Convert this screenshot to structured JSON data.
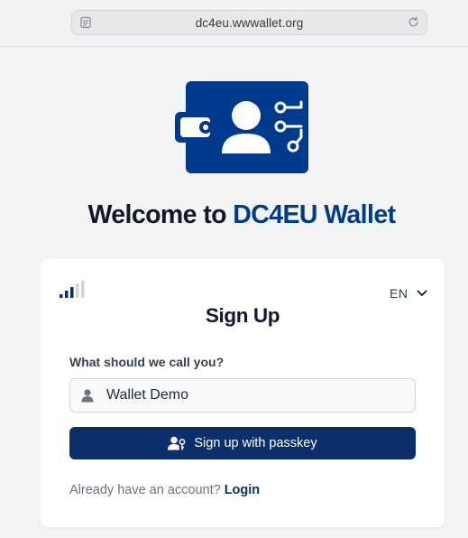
{
  "browser": {
    "url": "dc4eu.wwwallet.org",
    "reader_icon": "reader-mode-icon",
    "reload_icon": "reload-icon"
  },
  "logo": {
    "icon": "wallet-identity-circuit-logo",
    "color": "#003a8c"
  },
  "welcome": {
    "prefix": "Welcome to ",
    "brand": "DC4EU Wallet"
  },
  "card": {
    "connection_icon": "signal-strength-icon",
    "language": {
      "selected": "EN",
      "icon": "chevron-down-icon"
    },
    "title": "Sign Up",
    "name_field": {
      "label": "What should we call you?",
      "value": "Wallet Demo",
      "icon": "user-icon"
    },
    "passkey_button": {
      "label": "Sign up with passkey",
      "icon": "user-key-icon",
      "color": "#0b2f6b"
    },
    "account_prompt": {
      "text": "Already have an account?",
      "link": "Login"
    }
  }
}
